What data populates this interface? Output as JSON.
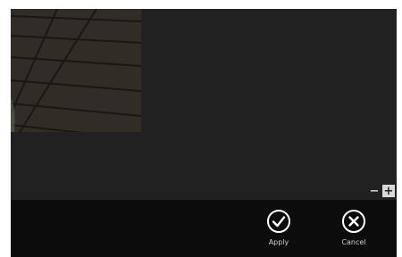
{
  "canvas": {
    "photo_description_name": "photo-preview"
  },
  "zoom": {
    "minus_symbol": "−",
    "plus_symbol": "+"
  },
  "app_bar": {
    "apply_label": "Apply",
    "cancel_label": "Cancel",
    "apply_icon": "checkmark-circle-icon",
    "cancel_icon": "close-circle-icon"
  },
  "colors": {
    "canvas_bg": "#212121",
    "app_bar_bg": "#0c0c0c",
    "icon_color": "#ffffff"
  }
}
